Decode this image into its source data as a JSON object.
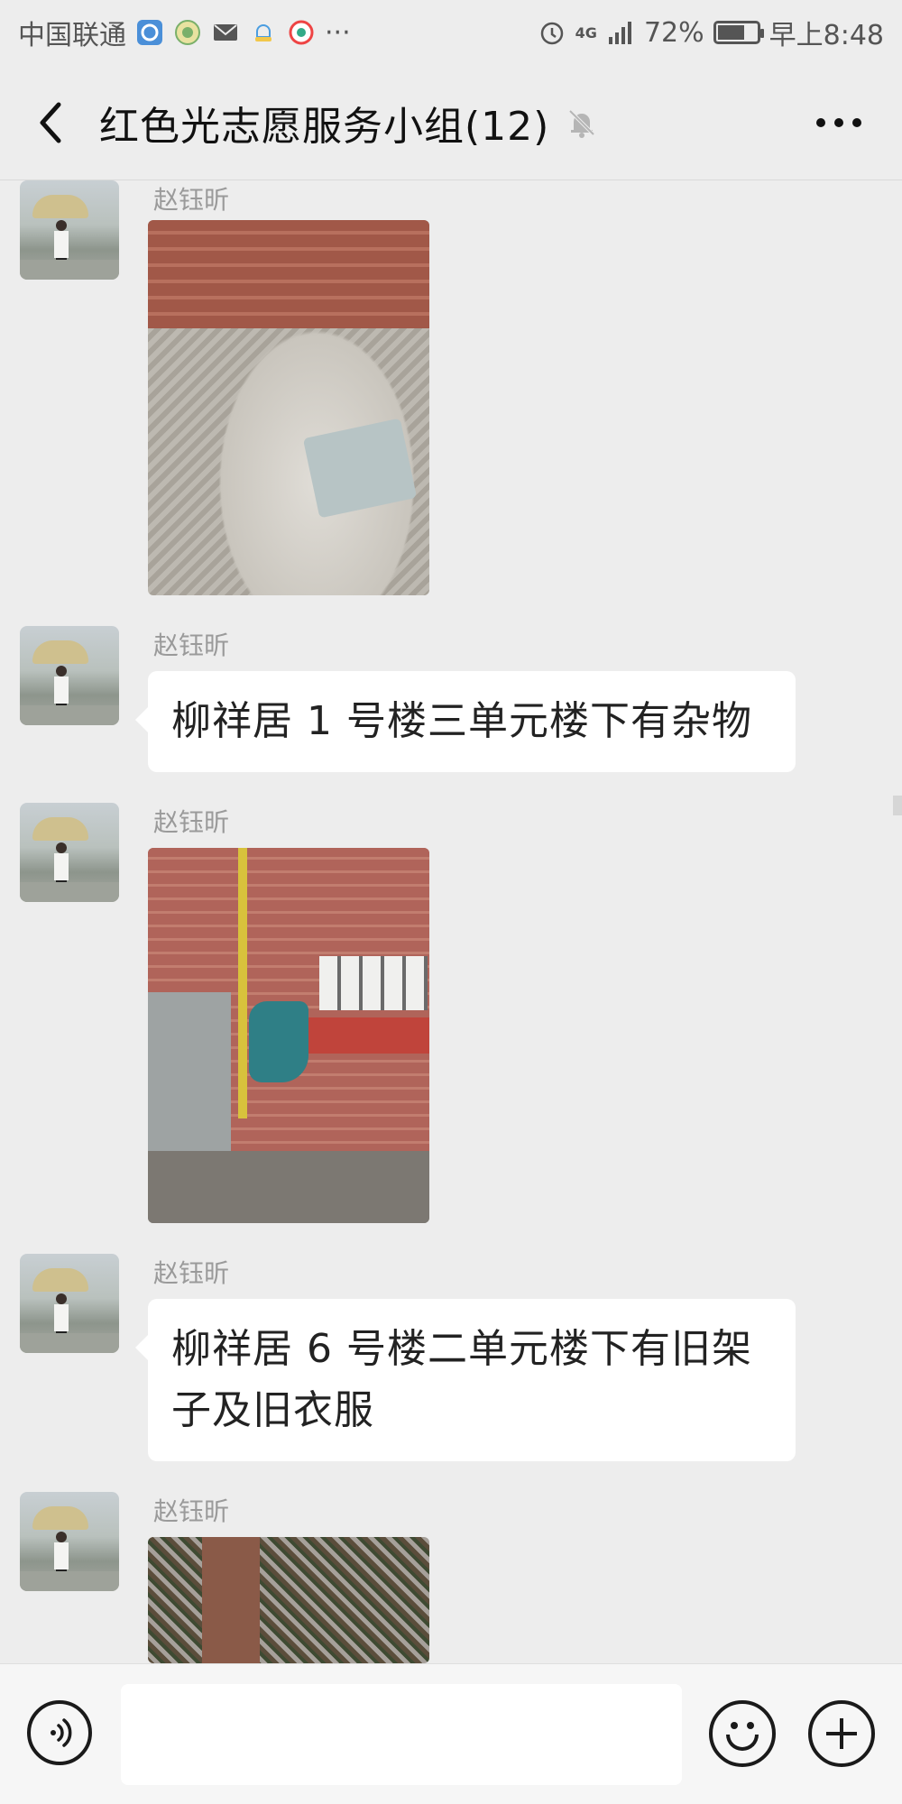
{
  "status_bar": {
    "carrier": "中国联通",
    "notification_icons": [
      "app-icon",
      "app-icon",
      "mail-icon",
      "app-icon",
      "app-icon"
    ],
    "more_indicator": "···",
    "network_type": "4G",
    "battery_percent": "72%",
    "battery_level": 0.72,
    "time": "早上8:48"
  },
  "header": {
    "title": "红色光志愿服务小组(12)",
    "muted": true
  },
  "messages": [
    {
      "sender": "赵钰昕",
      "type": "image",
      "image_desc": "rubble"
    },
    {
      "sender": "赵钰昕",
      "type": "text",
      "text": "柳祥居 1 号楼三单元楼下有杂物"
    },
    {
      "sender": "赵钰昕",
      "type": "image",
      "image_desc": "shelf"
    },
    {
      "sender": "赵钰昕",
      "type": "text",
      "text": "柳祥居 6 号楼二单元楼下有旧架子及旧衣服"
    },
    {
      "sender": "赵钰昕",
      "type": "image",
      "image_desc": "tree"
    }
  ],
  "input_bar": {
    "placeholder": "",
    "value": ""
  },
  "colors": {
    "background": "#ededed",
    "bubble": "#ffffff",
    "sender_name": "#9a9a9a",
    "input_bar": "#f6f6f6"
  }
}
